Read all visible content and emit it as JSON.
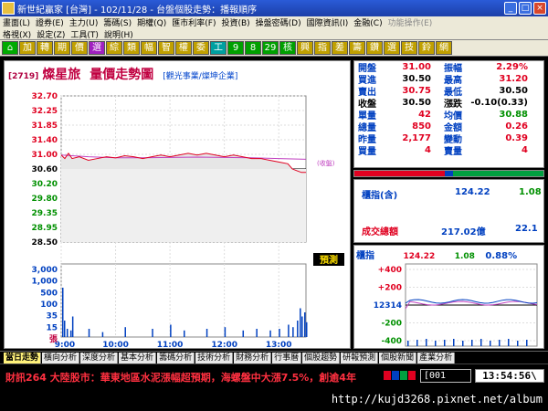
{
  "window": {
    "title": "新世紀贏家 [台灣] - 102/11/28 - 台盤個股走勢：播報順序"
  },
  "menu": {
    "row1": [
      "畫面(L)",
      "證券(E)",
      "主力(U)",
      "籌碼(S)",
      "期權(Q)",
      "匯市利率(F)",
      "投資(B)",
      "操盤密碼(D)",
      "國際資訊(I)",
      "金融(C)",
      "功能操作(E)"
    ],
    "row2": [
      "格視(X)",
      "設定(Z)",
      "工具(T)",
      "說明(H)"
    ]
  },
  "toolbar": {
    "buttons": [
      "⌂",
      "加",
      "轉",
      "期",
      "價",
      "選",
      "綜",
      "類",
      "幅",
      "智",
      "權",
      "委",
      "工",
      "9",
      "8",
      "29",
      "核",
      "興",
      "指",
      "差",
      "籌",
      "鑽",
      "選",
      "技",
      "鈴",
      "網"
    ]
  },
  "stock": {
    "code": "[2719]",
    "name": "燦星旅",
    "chart_title": "量價走勢圖",
    "industry": "[觀光事業/燦坤企業]",
    "prev_close_label": "(收盤)",
    "forecast_label": "預測"
  },
  "quote": {
    "rows": [
      {
        "l1": "開盤",
        "v1": "31.00",
        "c1": "red",
        "l2": "振幅",
        "v2": "2.29%",
        "c2": "red"
      },
      {
        "l1": "買進",
        "v1": "30.50",
        "c1": "blk",
        "l2": "最高",
        "v2": "31.20",
        "c2": "red"
      },
      {
        "l1": "賣出",
        "v1": "30.75",
        "c1": "red",
        "l2": "最低",
        "v2": "30.50",
        "c2": "blk"
      },
      {
        "l1": "收盤",
        "v1": "30.50",
        "c1": "blk",
        "l2": "漲跌",
        "v2": "-0.10(0.33)",
        "c2": "blk"
      },
      {
        "l1": "單量",
        "v1": "42",
        "c1": "red",
        "l2": "均價",
        "v2": "30.88",
        "c2": "grn"
      },
      {
        "l1": "總量",
        "v1": "850",
        "c1": "red",
        "l2": "金額",
        "v2": "0.26",
        "c2": "red"
      },
      {
        "l1": "昨量",
        "v1": "2,177",
        "c1": "red",
        "l2": "變動",
        "v2": "0.39",
        "c2": "red"
      },
      {
        "l1": "買量",
        "v1": "4",
        "c1": "red",
        "l2": "賣量",
        "v2": "4",
        "c2": "red"
      }
    ]
  },
  "index_info": {
    "label": "櫃指(含)",
    "value": "124.22",
    "change": "1.08",
    "turnover_label": "成交總額",
    "turnover_value": "217.02億",
    "turnover_change": "22.1"
  },
  "index_chart": {
    "label": "櫃指",
    "value": "124.22",
    "change": "1.08",
    "pct": "0.88%",
    "ticks": [
      "+400",
      "+200",
      "12314",
      "-200",
      "-400"
    ]
  },
  "chart_data": {
    "type": "line",
    "price_ticks": [
      "32.70",
      "32.25",
      "31.85",
      "31.40",
      "31.00",
      "30.60",
      "30.20",
      "29.80",
      "29.35",
      "28.95",
      "28.50"
    ],
    "volume_ticks": [
      "3,000",
      "1,000",
      "500",
      "100",
      "35",
      "15",
      "張"
    ],
    "time_ticks": [
      "9:00",
      "10:00",
      "11:00",
      "12:00",
      "13:00"
    ],
    "ylim": [
      28.5,
      32.7
    ],
    "ref_price": 30.6,
    "price": [
      [
        0,
        31.0
      ],
      [
        4,
        30.9
      ],
      [
        8,
        31.05
      ],
      [
        12,
        30.9
      ],
      [
        20,
        30.95
      ],
      [
        30,
        30.85
      ],
      [
        40,
        30.9
      ],
      [
        50,
        30.95
      ],
      [
        60,
        30.92
      ],
      [
        70,
        30.98
      ],
      [
        80,
        30.95
      ],
      [
        90,
        30.9
      ],
      [
        100,
        30.95
      ],
      [
        110,
        31.0
      ],
      [
        120,
        30.95
      ],
      [
        130,
        31.0
      ],
      [
        140,
        31.05
      ],
      [
        150,
        31.0
      ],
      [
        160,
        31.05
      ],
      [
        170,
        31.0
      ],
      [
        180,
        30.95
      ],
      [
        190,
        31.0
      ],
      [
        200,
        30.95
      ],
      [
        210,
        30.9
      ],
      [
        220,
        30.9
      ],
      [
        230,
        30.85
      ],
      [
        240,
        30.8
      ],
      [
        250,
        30.75
      ],
      [
        255,
        30.6
      ],
      [
        260,
        30.55
      ],
      [
        265,
        30.5
      ],
      [
        270,
        30.5
      ]
    ],
    "avg": [
      [
        0,
        31.0
      ],
      [
        30,
        30.95
      ],
      [
        60,
        30.92
      ],
      [
        90,
        30.92
      ],
      [
        120,
        30.93
      ],
      [
        150,
        30.94
      ],
      [
        180,
        30.93
      ],
      [
        210,
        30.92
      ],
      [
        240,
        30.9
      ],
      [
        270,
        30.88
      ]
    ],
    "volume": [
      [
        1,
        60
      ],
      [
        3,
        20
      ],
      [
        6,
        10
      ],
      [
        10,
        8
      ],
      [
        12,
        25
      ],
      [
        30,
        10
      ],
      [
        45,
        6
      ],
      [
        70,
        12
      ],
      [
        100,
        10
      ],
      [
        120,
        15
      ],
      [
        135,
        8
      ],
      [
        160,
        10
      ],
      [
        180,
        12
      ],
      [
        200,
        8
      ],
      [
        215,
        10
      ],
      [
        230,
        8
      ],
      [
        240,
        10
      ],
      [
        250,
        15
      ],
      [
        255,
        12
      ],
      [
        260,
        20
      ],
      [
        263,
        35
      ],
      [
        265,
        25
      ],
      [
        268,
        30
      ],
      [
        270,
        18
      ]
    ]
  },
  "tabs": [
    "當日走勢",
    "橫向分析",
    "深度分析",
    "基本分析",
    "籌碼分析",
    "技術分析",
    "財務分析",
    "行事曆",
    "個股趨勢",
    "研報預測",
    "個股新聞",
    "產業分析"
  ],
  "status": {
    "ticker": "財訊264 大陸股市：華東地區水泥漲幅超預期，海螺盤中大漲7.5%，創逾4年",
    "code_input": "[001",
    "clock": "13:54:56\\",
    "watermark": "http://kujd3268.pixnet.net/album"
  },
  "colors": {
    "accent_red": "#e00020",
    "accent_blue": "#0040c0",
    "avg_purple": "#c040c0"
  }
}
